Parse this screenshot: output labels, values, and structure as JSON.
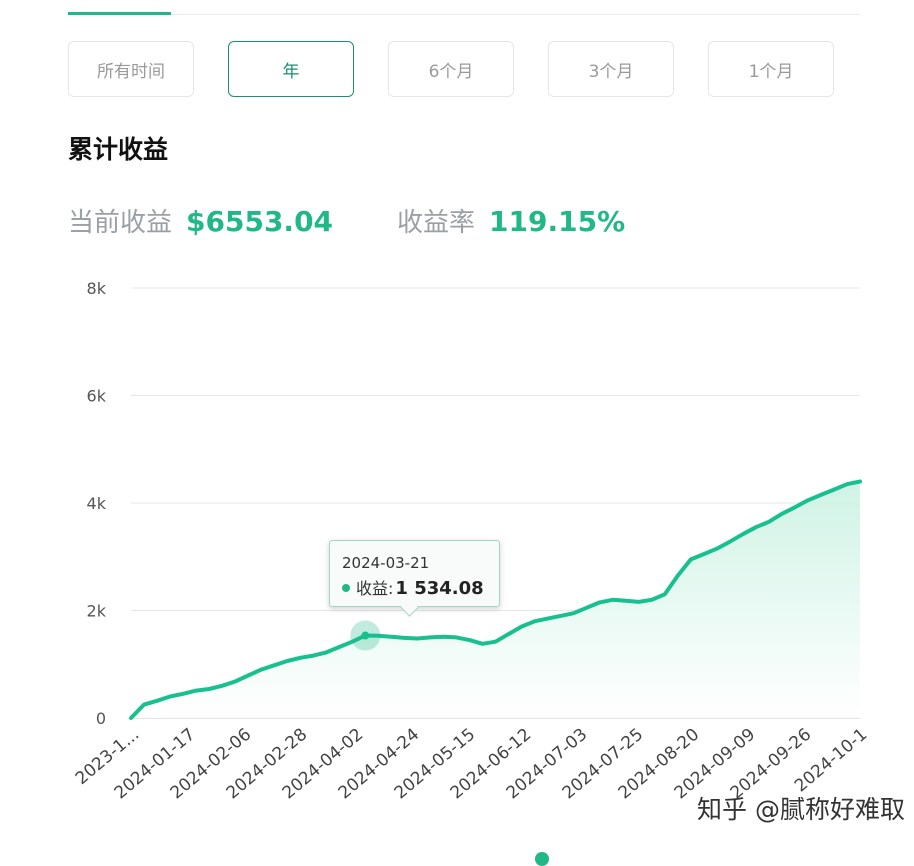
{
  "ranges": [
    {
      "label": "所有时间",
      "active": false
    },
    {
      "label": "年",
      "active": true
    },
    {
      "label": "6个月",
      "active": false
    },
    {
      "label": "3个月",
      "active": false
    },
    {
      "label": "1个月",
      "active": false
    }
  ],
  "section_title": "累计收益",
  "stats": {
    "current_label": "当前收益",
    "current_value": "$6553.04",
    "rate_label": "收益率",
    "rate_value": "119.15%"
  },
  "colors": {
    "accent": "#20b887",
    "line": "#18c08f",
    "area": "#d3f4e8"
  },
  "tooltip": {
    "date": "2024-03-21",
    "label": "收益:",
    "value": "1 534.08"
  },
  "watermark": "知乎 @腻称好难取",
  "chart_data": {
    "type": "area",
    "title": "累计收益",
    "xlabel": "",
    "ylabel": "",
    "ylim": [
      0,
      8000
    ],
    "y_ticks": [
      0,
      2000,
      4000,
      6000,
      8000
    ],
    "y_tick_labels": [
      "0",
      "2k",
      "4k",
      "6k",
      "8k"
    ],
    "x_tick_labels": [
      "2023-1...",
      "2024-01-17",
      "2024-02-06",
      "2024-02-28",
      "2024-04-02",
      "2024-04-24",
      "2024-05-15",
      "2024-06-12",
      "2024-07-03",
      "2024-07-25",
      "2024-08-20",
      "2024-09-09",
      "2024-09-26",
      "2024-10-1"
    ],
    "grid": true,
    "legend": "bottom",
    "highlight": {
      "date": "2024-03-21",
      "value": 1534.08
    },
    "series": [
      {
        "values": [
          0,
          250,
          320,
          400,
          450,
          510,
          540,
          600,
          680,
          790,
          900,
          980,
          1060,
          1120,
          1160,
          1220,
          1320,
          1420,
          1534.08,
          1530,
          1510,
          1490,
          1480,
          1500,
          1510,
          1500,
          1450,
          1380,
          1420,
          1560,
          1700,
          1800,
          1850,
          1900,
          1950,
          2050,
          2150,
          2200,
          2180,
          2160,
          2200,
          2300,
          2650,
          2950,
          3050,
          3150,
          3280,
          3420,
          3550,
          3650,
          3800,
          3920,
          4050,
          4150,
          4250,
          4350,
          4400
        ]
      }
    ]
  }
}
